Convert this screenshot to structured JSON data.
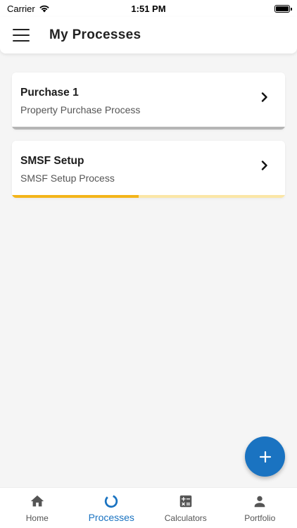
{
  "status_bar": {
    "carrier": "Carrier",
    "time": "1:51 PM"
  },
  "header": {
    "title": "My Processes",
    "menu_icon": "hamburger-menu-icon"
  },
  "processes": [
    {
      "title": "Purchase 1",
      "subtitle": "Property Purchase Process",
      "progress": 1.0,
      "progress_color": "#b5b5b5",
      "track_color": "#b5b5b5"
    },
    {
      "title": "SMSF Setup",
      "subtitle": "SMSF Setup Process",
      "progress": 0.465,
      "progress_color": "#f3b51b",
      "track_color": "#fbe6a6"
    }
  ],
  "fab": {
    "icon": "plus-icon",
    "color": "#1a73c1"
  },
  "bottom_nav": {
    "active_color": "#1a73c1",
    "items": [
      {
        "label": "Home",
        "icon": "home-icon"
      },
      {
        "label": "Processes",
        "icon": "processes-icon"
      },
      {
        "label": "Calculators",
        "icon": "calculator-icon"
      },
      {
        "label": "Portfolio",
        "icon": "person-icon"
      }
    ]
  }
}
